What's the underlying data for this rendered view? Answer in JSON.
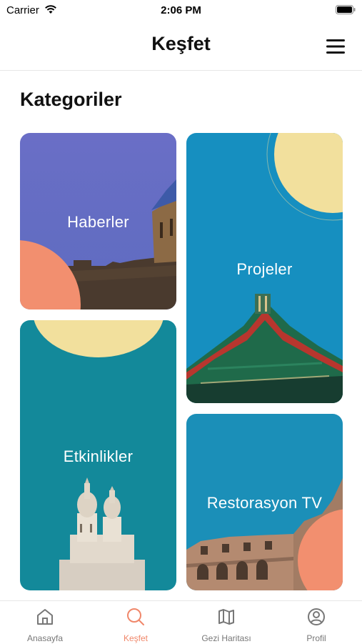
{
  "status_bar": {
    "carrier": "Carrier",
    "time": "2:06 PM"
  },
  "header": {
    "title": "Keşfet",
    "menu_icon": "hamburger-menu-icon"
  },
  "main": {
    "section_title": "Kategoriler",
    "categories": [
      {
        "label": "Haberler"
      },
      {
        "label": "Projeler"
      },
      {
        "label": "Etkinlikler"
      },
      {
        "label": "Restorasyon TV"
      }
    ]
  },
  "tab_bar": {
    "active": "Keşfet",
    "active_color": "#f0876a",
    "items": [
      {
        "label": "Anasayfa",
        "icon": "home-icon"
      },
      {
        "label": "Keşfet",
        "icon": "search-icon"
      },
      {
        "label": "Gezi Haritası",
        "icon": "map-icon"
      },
      {
        "label": "Profil",
        "icon": "profile-icon"
      }
    ]
  }
}
